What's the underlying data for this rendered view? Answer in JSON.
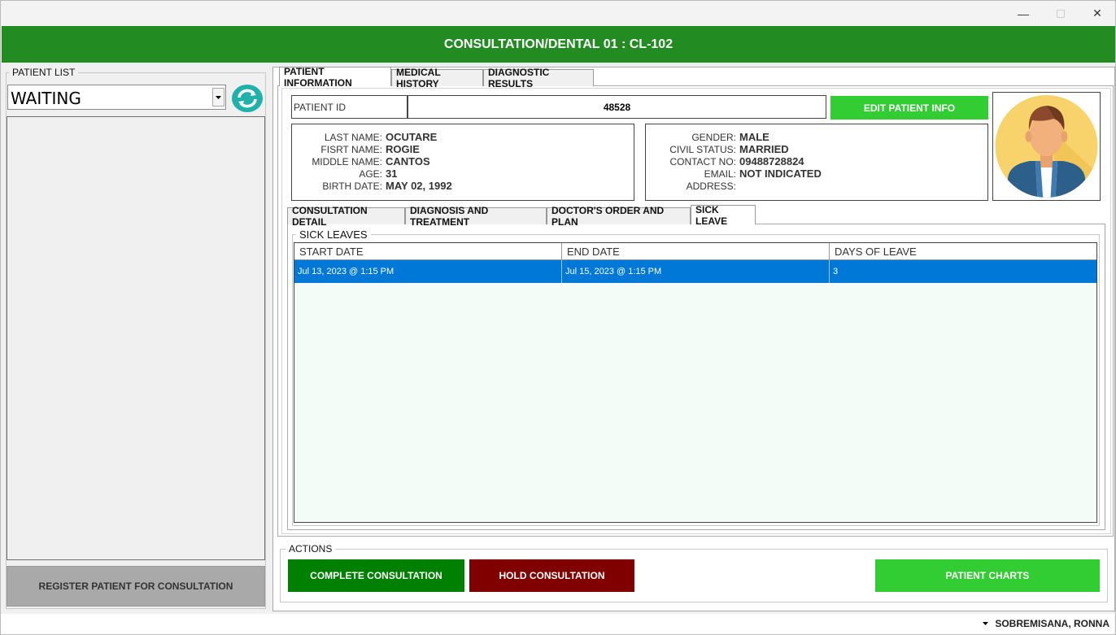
{
  "window": {
    "min_glyph": "—",
    "close_glyph": "✕"
  },
  "header": {
    "title": "CONSULTATION/DENTAL 01 : CL-102"
  },
  "patient_list": {
    "legend": "PATIENT LIST",
    "status_selected": "WAITING",
    "register_label": "REGISTER PATIENT FOR CONSULTATION"
  },
  "main_tabs": [
    "PATIENT INFORMATION",
    "MEDICAL HISTORY",
    "DIAGNOSTIC RESULTS"
  ],
  "patient": {
    "id_label": "PATIENT ID",
    "id_value": "48528",
    "edit_label": "EDIT PATIENT INFO",
    "left_fields": [
      {
        "label": "LAST NAME:",
        "value": "OCUTARE"
      },
      {
        "label": "FISRT NAME:",
        "value": "ROGIE"
      },
      {
        "label": "MIDDLE NAME:",
        "value": "CANTOS"
      },
      {
        "label": "AGE:",
        "value": "31"
      },
      {
        "label": "BIRTH DATE:",
        "value": "MAY 02, 1992"
      }
    ],
    "right_fields": [
      {
        "label": "GENDER:",
        "value": "MALE"
      },
      {
        "label": "CIVIL STATUS:",
        "value": "MARRIED"
      },
      {
        "label": "CONTACT NO:",
        "value": "09488728824"
      },
      {
        "label": "EMAIL:",
        "value": "NOT INDICATED"
      },
      {
        "label": "ADDRESS:",
        "value": ""
      }
    ]
  },
  "sub_tabs": [
    "CONSULTATION DETAIL",
    "DIAGNOSIS AND TREATMENT",
    "DOCTOR'S ORDER AND PLAN",
    "SICK LEAVE"
  ],
  "sick_leave": {
    "legend": "SICK LEAVES",
    "columns": [
      "START DATE",
      "END DATE",
      "DAYS OF LEAVE"
    ],
    "rows": [
      [
        "Jul 13, 2023 @ 1:15 PM",
        "Jul 15, 2023 @ 1:15 PM",
        "3"
      ]
    ]
  },
  "actions": {
    "legend": "ACTIONS",
    "complete_label": "COMPLETE CONSULTATION",
    "hold_label": "HOLD CONSULTATION",
    "charts_label": "PATIENT CHARTS"
  },
  "status_bar": {
    "user": "SOBREMISANA, RONNA"
  },
  "colors": {
    "header_green": "#228b22",
    "edit_green": "#32cd32",
    "complete_green": "#008000",
    "hold_red": "#800000",
    "selection_blue": "#0078d7"
  }
}
